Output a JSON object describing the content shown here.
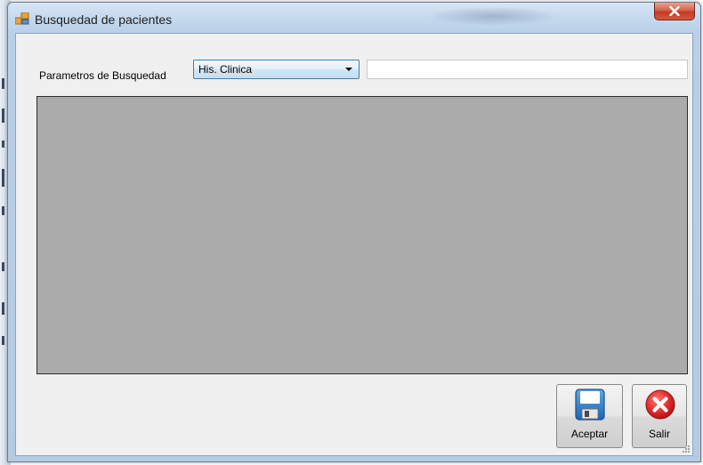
{
  "window": {
    "title": "Busquedad de pacientes"
  },
  "search": {
    "label": "Parametros de Busquedad",
    "selected_option": "His. Clinica",
    "query_value": ""
  },
  "buttons": {
    "accept_label": "Aceptar",
    "exit_label": "Salir"
  },
  "icons": {
    "app": "form-window-icon",
    "close": "close-icon",
    "dropdown": "chevron-down-icon",
    "accept": "floppy-disk-icon",
    "exit": "red-circle-x-icon"
  },
  "colors": {
    "grid_background": "#ababab",
    "client_background": "#f0f0f0",
    "close_button": "#c23a22",
    "accept_icon": "#2f7fc6",
    "exit_icon": "#d9282b"
  }
}
